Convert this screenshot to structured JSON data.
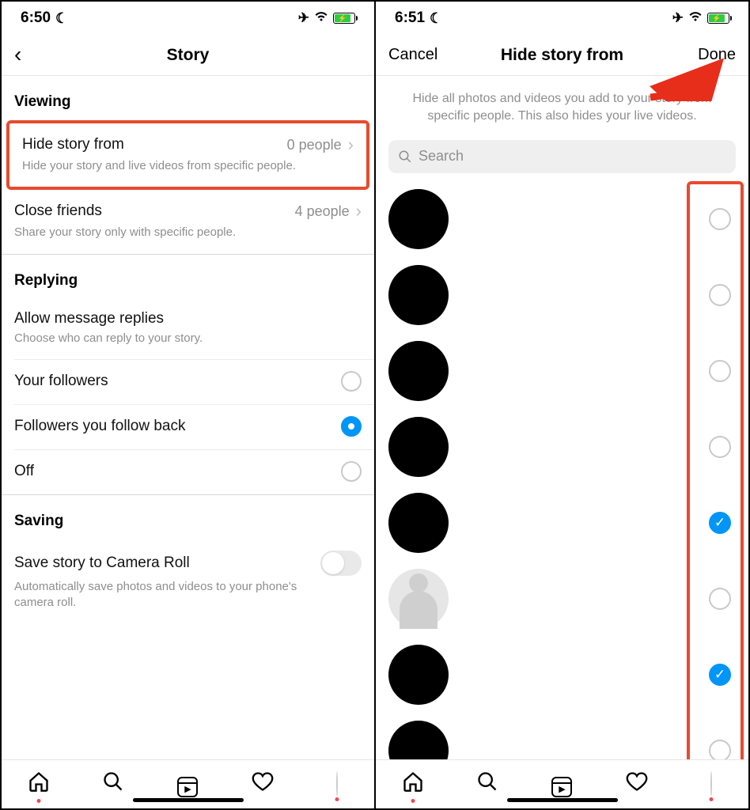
{
  "left": {
    "status_time": "6:50",
    "nav_title": "Story",
    "sections": {
      "viewing_header": "Viewing",
      "hide_title": "Hide story from",
      "hide_value": "0 people",
      "hide_sub": "Hide your story and live videos from specific people.",
      "close_title": "Close friends",
      "close_value": "4 people",
      "close_sub": "Share your story only with specific people.",
      "replying_header": "Replying",
      "allow_title": "Allow message replies",
      "allow_sub": "Choose who can reply to your story.",
      "opt_followers": "Your followers",
      "opt_back": "Followers you follow back",
      "opt_off": "Off",
      "saving_header": "Saving",
      "save_title": "Save story to Camera Roll",
      "save_sub": "Automatically save photos and videos to your phone's camera roll."
    }
  },
  "right": {
    "status_time": "6:51",
    "cancel": "Cancel",
    "nav_title": "Hide story from",
    "done": "Done",
    "instructions": "Hide all photos and videos you add to your story from specific people. This also hides your live videos.",
    "search_placeholder": "Search",
    "people_selected": [
      false,
      false,
      false,
      false,
      true,
      false,
      true,
      false
    ]
  }
}
